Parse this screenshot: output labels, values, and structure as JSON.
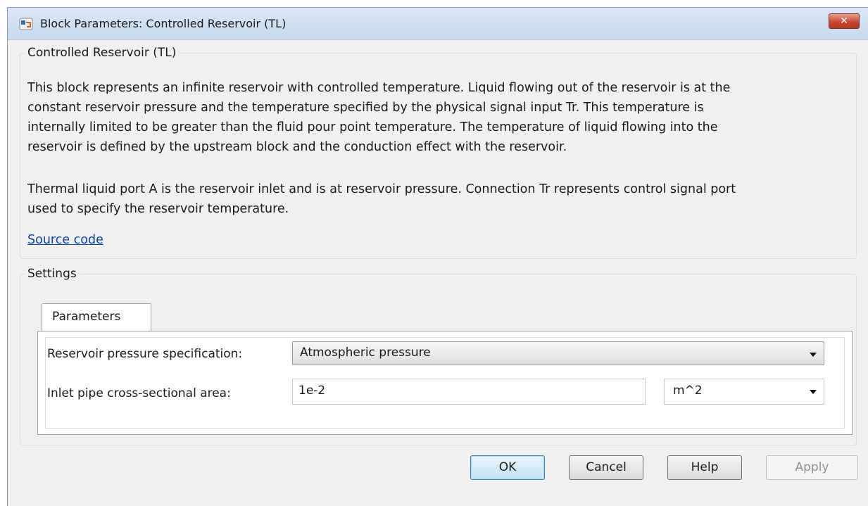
{
  "window": {
    "title": "Block Parameters: Controlled Reservoir (TL)",
    "close_glyph": "✕"
  },
  "description_group": {
    "legend": "Controlled Reservoir (TL)",
    "lines1": [
      "This block represents an infinite reservoir with controlled temperature. Liquid flowing out of the reservoir is at the",
      "constant reservoir pressure and the temperature specified by the physical signal input Tr. This temperature is",
      "internally limited to be greater than the fluid pour point temperature. The temperature of liquid flowing into the",
      "reservoir is defined by the upstream block and the conduction effect with the reservoir."
    ],
    "lines2": [
      "Thermal liquid port A is the reservoir inlet and is at reservoir pressure. Connection Tr represents control signal port",
      "used to specify the reservoir temperature."
    ],
    "source_link": "Source code"
  },
  "settings": {
    "legend": "Settings",
    "tab": "Parameters",
    "pressure_label": "Reservoir pressure specification:",
    "pressure_value": "Atmospheric pressure",
    "area_label": "Inlet pipe cross-sectional area:",
    "area_value": "1e-2",
    "area_unit": "m^2"
  },
  "buttons": {
    "ok": "OK",
    "cancel": "Cancel",
    "help": "Help",
    "apply": "Apply"
  },
  "icons": {
    "app": "simulink-block-icon",
    "close": "close-icon",
    "dropdown": "chevron-down-icon"
  },
  "colors": {
    "link": "#0a3fb2",
    "close": "#c8432c",
    "default_button": "#c4e3f7"
  }
}
